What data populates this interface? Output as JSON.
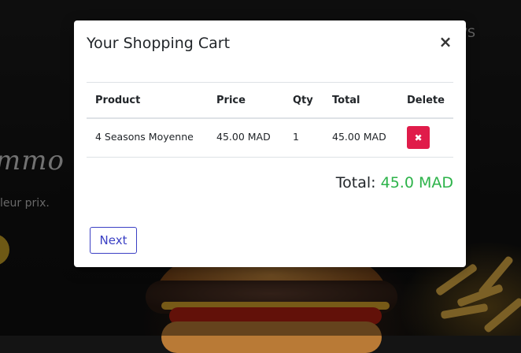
{
  "background": {
    "nav_item": "WS",
    "hero_title": "mmo",
    "hero_subtitle": "leur prix."
  },
  "modal": {
    "title": "Your Shopping Cart",
    "close_label": "×",
    "columns": [
      "Product",
      "Price",
      "Qty",
      "Total",
      "Delete"
    ],
    "items": [
      {
        "product": "4 Seasons Moyenne",
        "price": "45.00 MAD",
        "qty": "1",
        "total": "45.00 MAD",
        "delete_icon": "✖"
      }
    ],
    "total_label": "Total:",
    "total_value": "45.0 MAD",
    "next_label": "Next"
  },
  "colors": {
    "delete_button": "#e01c4a",
    "total_amount": "#2db34a",
    "next_button": "#3b40c4",
    "cta_gold": "#c9a227"
  }
}
